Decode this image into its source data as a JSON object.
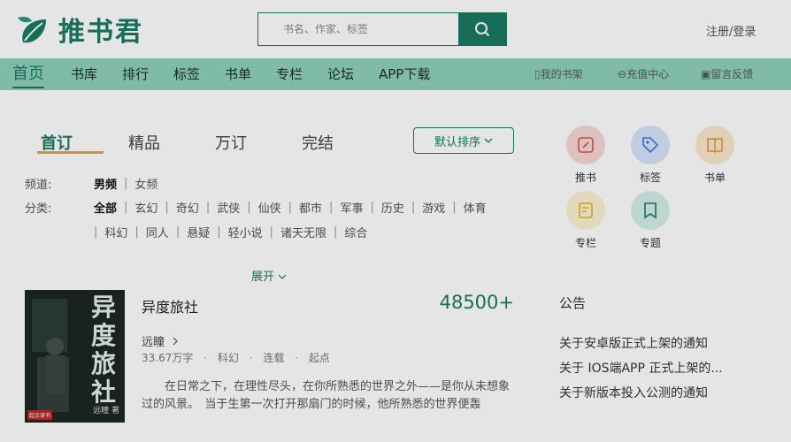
{
  "brand": {
    "name": "推书君"
  },
  "search": {
    "placeholder": "书名、作家、标签"
  },
  "header": {
    "login_label": "注册/登录"
  },
  "nav": {
    "items": [
      "首页",
      "书库",
      "排行",
      "标签",
      "书单",
      "专栏",
      "论坛",
      "APP下载"
    ],
    "active": "首页",
    "right": [
      "我的书架",
      "充值中心",
      "留言反馈"
    ]
  },
  "tabs": [
    "首订",
    "精品",
    "万订",
    "完结"
  ],
  "sort": {
    "label": "默认排序"
  },
  "filters": {
    "channel_label": "频道:",
    "channels": [
      "男频",
      "女频"
    ],
    "category_label": "分类:",
    "categories_row1": [
      "全部",
      "玄幻",
      "奇幻",
      "武侠",
      "仙侠",
      "都市",
      "军事",
      "历史",
      "游戏",
      "体育"
    ],
    "categories_row2": [
      "科幻",
      "同人",
      "悬疑",
      "轻小说",
      "诸天无限",
      "综合"
    ]
  },
  "expand": {
    "label": "展开"
  },
  "book": {
    "title": "异度旅社",
    "score": "48500+",
    "author": "远瞳",
    "meta": [
      "33.67万字",
      "科幻",
      "连载",
      "起点"
    ],
    "description": "在日常之下，在理性尽头，在你所熟悉的世界之外——是你从未想象过的风景。　当于生第一次打开那扇门的时候，他所熟悉的世界便轰",
    "cover": {
      "title": "异度旅社",
      "author": "远瞳 著",
      "badge": "起点读书"
    }
  },
  "quick_links": [
    {
      "label": "推书",
      "icon": "pen-icon",
      "color": "#f7d6d6",
      "fg": "#d9534f"
    },
    {
      "label": "标签",
      "icon": "tag-icon",
      "color": "#d6e4fa",
      "fg": "#3b7be0"
    },
    {
      "label": "书单",
      "icon": "book-icon",
      "color": "#fbe8cf",
      "fg": "#e49a2b"
    },
    {
      "label": "专栏",
      "icon": "edit-icon",
      "color": "#fbf2cf",
      "fg": "#e0b22b"
    },
    {
      "label": "专题",
      "icon": "bookmark-icon",
      "color": "#d3efe7",
      "fg": "#1a7a62"
    }
  ],
  "notice": {
    "title": "公告",
    "items": [
      "关于安卓版正式上架的通知",
      "关于 IOS端APP 正式上架的...",
      "关于新版本投入公测的通知"
    ]
  }
}
